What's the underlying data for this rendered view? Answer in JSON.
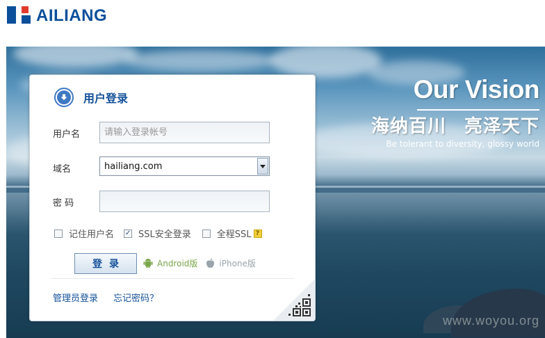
{
  "header": {
    "logo_text": "AILIANG"
  },
  "banner": {
    "title": "Our Vision",
    "slogan_cn_1": "海纳百川",
    "slogan_cn_2": "亮泽天下",
    "slogan_en": "Be tolerant to diversity, glossy world",
    "watermark": "www.woyou.org"
  },
  "login": {
    "title": "用户登录",
    "username_label": "用户名",
    "username_placeholder": "请输入登录帐号",
    "username_value": "",
    "domain_label": "域名",
    "domain_value": "hailiang.com",
    "password_label": "密 码",
    "password_value": "",
    "remember_label": "记住用户名",
    "remember_checked": false,
    "ssl_label": "SSL安全登录",
    "ssl_checked": true,
    "full_ssl_label": "全程SSL",
    "full_ssl_checked": false,
    "help_glyph": "?",
    "submit_label": "登录",
    "android_label": "Android版",
    "iphone_label": "iPhone版",
    "admin_login_label": "管理员登录",
    "forgot_label": "忘记密码？"
  },
  "colors": {
    "brand_blue": "#0b4f9a",
    "brand_red": "#e23a2d",
    "link_blue": "#14519a",
    "android_green": "#7aa54a"
  }
}
